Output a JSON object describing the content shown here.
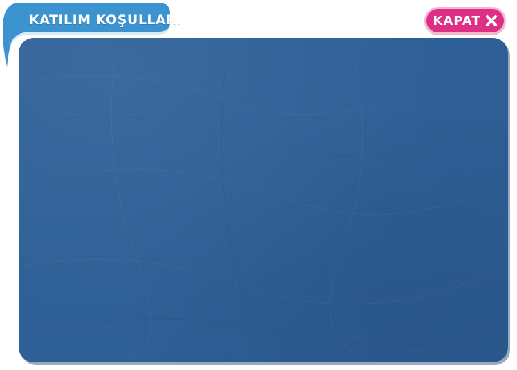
{
  "header": {
    "title": "KATILIM KOŞULLARI"
  },
  "close_button": {
    "label": "KAPAT",
    "icon": "close-icon"
  },
  "colors": {
    "panel": "#2e5f96",
    "title_tab": "#3b93cf",
    "close_button": "#dd2f86"
  }
}
